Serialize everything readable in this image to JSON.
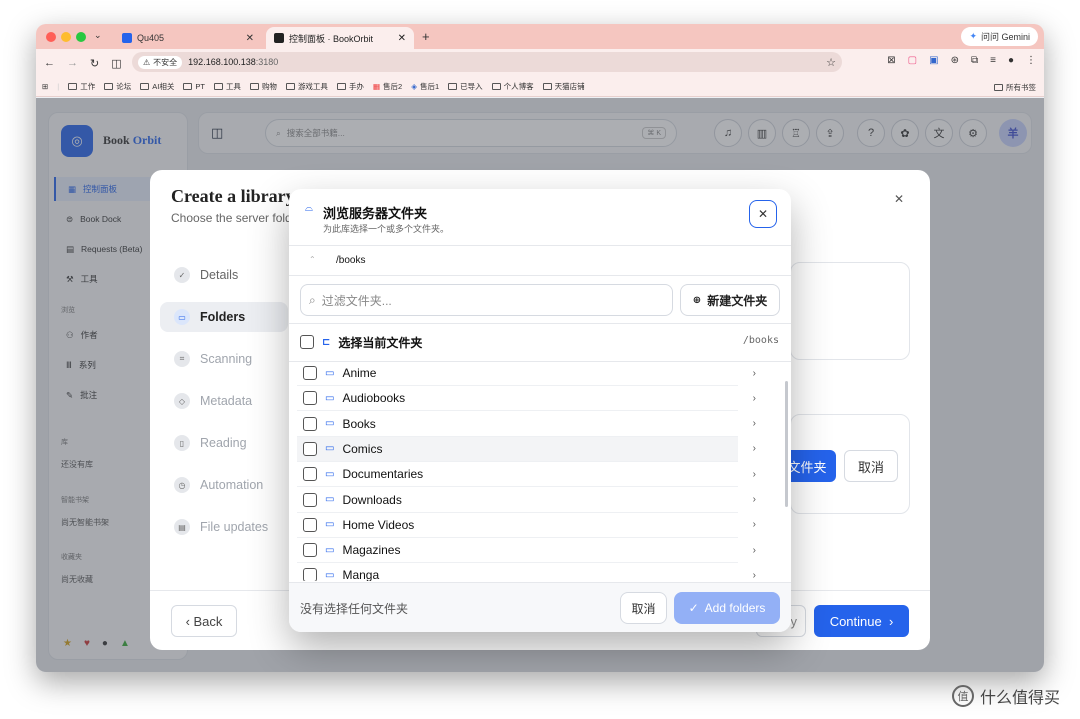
{
  "browser": {
    "tabs": [
      {
        "label": "Qu405",
        "active": false
      },
      {
        "label": "控制面板 · BookOrbit",
        "active": true
      }
    ],
    "gemini_label": "问问 Gemini",
    "not_secure": "不安全",
    "url_host": "192.168.100.138",
    "url_port": ":3180",
    "bookmarks": [
      "工作",
      "论坛",
      "AI相关",
      "PT",
      "工具",
      "购物",
      "游戏工具",
      "手办",
      "售后2",
      "售后1",
      "已导入",
      "个人博客",
      "天猫店铺"
    ],
    "all_bookmarks": "所有书签"
  },
  "app": {
    "brand_a": "Book",
    "brand_b": "Orbit",
    "search_placeholder": "搜索全部书籍...",
    "search_kbd": "⌘ K",
    "avatar": "羊",
    "nav": [
      {
        "label": "控制面板",
        "active": true
      },
      {
        "label": "Book Dock"
      },
      {
        "label": "Requests (Beta)"
      },
      {
        "label": "工具"
      }
    ],
    "section_browse": "浏览",
    "nav2": [
      {
        "label": "作者"
      },
      {
        "label": "系列"
      },
      {
        "label": "批注"
      }
    ],
    "section_library": "库",
    "library_empty": "还没有库",
    "section_smart": "智能书架",
    "smart_empty": "尚无智能书架",
    "section_fav": "收藏夹",
    "fav_empty": "尚无收藏"
  },
  "wizard": {
    "title": "Create a library",
    "subtitle": "Choose the server folders",
    "steps": [
      {
        "label": "Details",
        "state": "done"
      },
      {
        "label": "Folders",
        "state": "active"
      },
      {
        "label": "Scanning",
        "state": "pending"
      },
      {
        "label": "Metadata",
        "state": "pending"
      },
      {
        "label": "Reading",
        "state": "pending"
      },
      {
        "label": "Automation",
        "state": "pending"
      },
      {
        "label": "File updates",
        "state": "pending"
      }
    ],
    "browse_btn": "文件夹",
    "cancel_btn": "取消",
    "back_btn": "Back",
    "continue_btn": "Continue",
    "partial_btn": "y"
  },
  "dialog": {
    "title": "浏览服务器文件夹",
    "subtitle": "为此库选择一个或多个文件夹。",
    "path": "/books",
    "filter_placeholder": "过滤文件夹...",
    "new_folder": "新建文件夹",
    "select_current": "选择当前文件夹",
    "select_current_path": "/books",
    "folders": [
      "Anime",
      "Audiobooks",
      "Books",
      "Comics",
      "Documentaries",
      "Downloads",
      "Home Videos",
      "Magazines",
      "Manga"
    ],
    "none_selected": "没有选择任何文件夹",
    "cancel": "取消",
    "add": "Add folders"
  },
  "watermark": "什么值得买",
  "colors": {
    "accent": "#2563eb",
    "add_disabled": "#93b0f6"
  }
}
